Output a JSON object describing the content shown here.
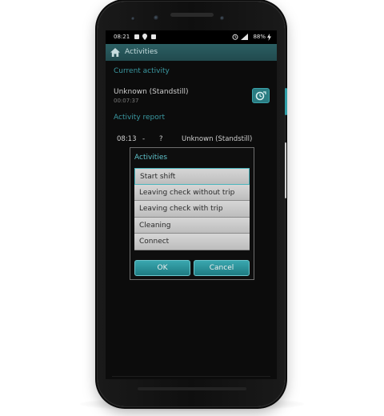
{
  "statusbar": {
    "time": "08:21",
    "battery": "88%"
  },
  "appbar": {
    "title": "Activities"
  },
  "current_activity": {
    "header": "Current activity",
    "name": "Unknown (Standstill)",
    "elapsed": "00:07:37"
  },
  "activity_report": {
    "header": "Activity report",
    "rows": [
      {
        "start": "08:13",
        "sep": "-",
        "end": "?",
        "name": "Unknown (Standstill)"
      }
    ]
  },
  "dialog": {
    "title": "Activities",
    "items": [
      {
        "label": "Start shift"
      },
      {
        "label": "Leaving check without trip"
      },
      {
        "label": "Leaving check with trip"
      },
      {
        "label": "Cleaning"
      },
      {
        "label": "Connect"
      }
    ],
    "ok_label": "OK",
    "cancel_label": "Cancel"
  },
  "colors": {
    "accent": "#3a98a1",
    "appbar": "#2b5f63",
    "button": "#2a8a92"
  },
  "icons": {
    "home": "home-icon",
    "activity_button": "activity-switch-icon"
  }
}
